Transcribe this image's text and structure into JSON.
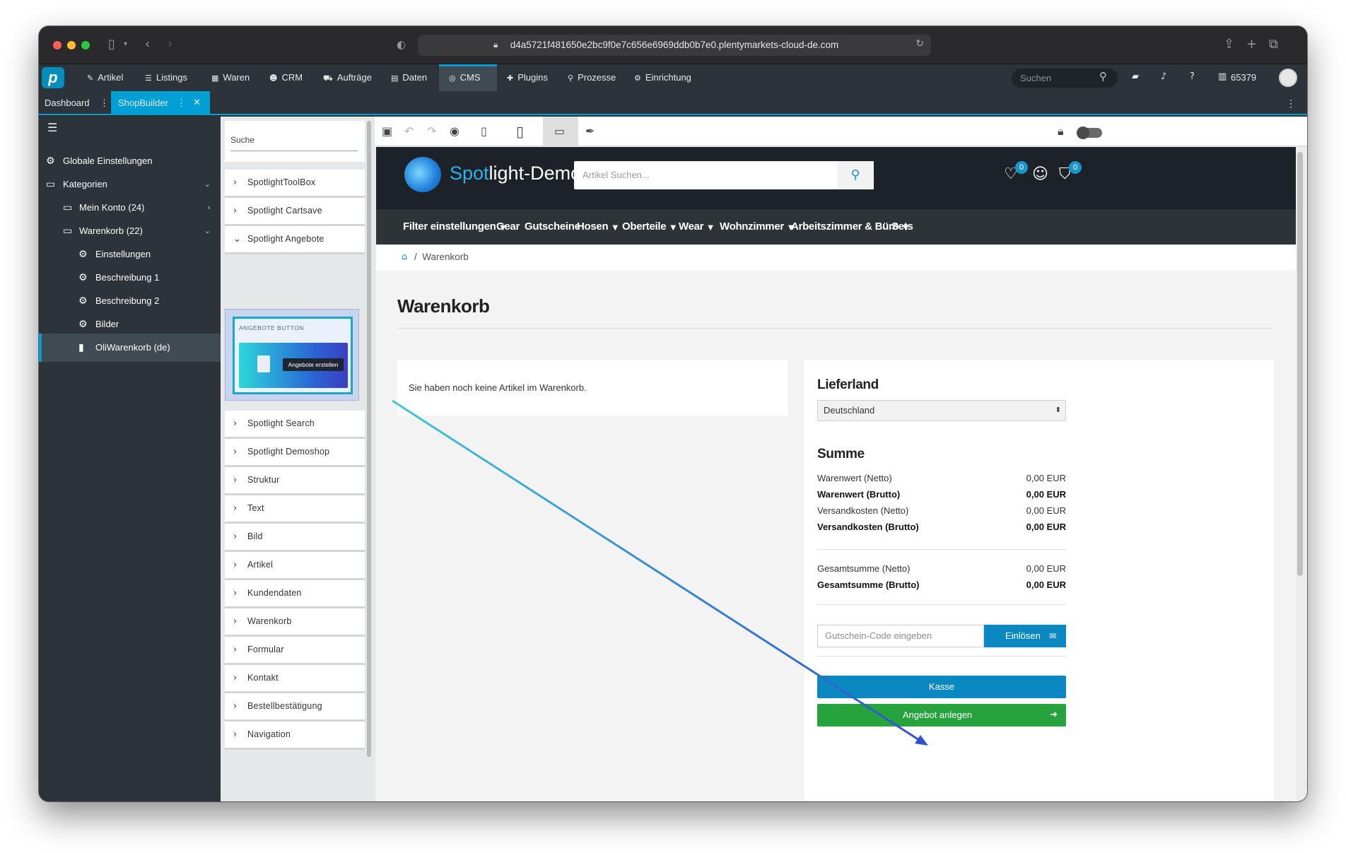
{
  "browser": {
    "url": "d4a5721f481650e2bc9f0e7c656e6969ddb0b7e0.plentymarkets-cloud-de.com"
  },
  "topnav": {
    "items": [
      {
        "label": "Artikel",
        "icon": "tag-icon"
      },
      {
        "label": "Listings",
        "icon": "list-icon"
      },
      {
        "label": "Waren",
        "icon": "boxes-icon"
      },
      {
        "label": "CRM",
        "icon": "users-icon"
      },
      {
        "label": "Aufträge",
        "icon": "cart-icon"
      },
      {
        "label": "Daten",
        "icon": "database-icon"
      },
      {
        "label": "CMS",
        "icon": "cms-icon"
      },
      {
        "label": "Plugins",
        "icon": "puzzle-icon"
      },
      {
        "label": "Prozesse",
        "icon": "flow-icon"
      },
      {
        "label": "Einrichtung",
        "icon": "gear-icon"
      }
    ],
    "active": "CMS",
    "search_placeholder": "Suchen",
    "account_number": "65379"
  },
  "tabs": {
    "dashboard": "Dashboard",
    "shopbuilder": "ShopBuilder"
  },
  "sidebar": {
    "items": [
      {
        "label": "Globale Einstellungen",
        "icon": "gear-icon"
      },
      {
        "label": "Kategorien",
        "icon": "window-icon"
      },
      {
        "label": "Mein Konto (24)",
        "icon": "window-icon"
      },
      {
        "label": "Warenkorb (22)",
        "icon": "window-icon"
      },
      {
        "label": "Einstellungen",
        "icon": "gear-icon"
      },
      {
        "label": "Beschreibung 1",
        "icon": "gear-icon"
      },
      {
        "label": "Beschreibung 2",
        "icon": "gear-icon"
      },
      {
        "label": "Bilder",
        "icon": "gear-icon"
      },
      {
        "label": "OliWarenkorb (de)",
        "icon": "file-icon"
      }
    ],
    "active": "OliWarenkorb (de)"
  },
  "widgets": {
    "search_label": "Suche",
    "items": [
      "SpotlightToolBox",
      "Spotlight Cartsave",
      "Spotlight Angebote",
      "Spotlight Search",
      "Spotlight Demoshop",
      "Struktur",
      "Text",
      "Bild",
      "Artikel",
      "Kundendaten",
      "Warenkorb",
      "Formular",
      "Kontakt",
      "Bestellbestätigung",
      "Navigation"
    ],
    "expanded": "Spotlight Angebote",
    "preview_label": "ANGEBOTE BUTTON",
    "preview_button": "Angebote erstellen"
  },
  "shop": {
    "logo_part1": "Spot",
    "logo_part2": "light-Demos",
    "search_placeholder": "Artikel Suchen...",
    "wishlist_count": "0",
    "cart_count": "0",
    "nav": [
      {
        "label": "Filter einstellungen",
        "dropdown": true
      },
      {
        "label": "Gear",
        "dropdown": false
      },
      {
        "label": "Gutscheine",
        "dropdown": false
      },
      {
        "label": "Hosen",
        "dropdown": true
      },
      {
        "label": "Oberteile",
        "dropdown": true
      },
      {
        "label": "Wear",
        "dropdown": true
      },
      {
        "label": "Wohnzimmer",
        "dropdown": true
      },
      {
        "label": "Arbeitszimmer & Büro",
        "dropdown": true
      },
      {
        "label": "Sets",
        "dropdown": false
      }
    ],
    "breadcrumb_sep": "/",
    "breadcrumb": "Warenkorb",
    "page_title": "Warenkorb",
    "empty_message": "Sie haben noch keine Artikel im Warenkorb.",
    "summary": {
      "country_heading": "Lieferland",
      "country_value": "Deutschland",
      "sum_heading": "Summe",
      "rows": [
        {
          "label": "Warenwert (Netto)",
          "value": "0,00 EUR",
          "bold": false
        },
        {
          "label": "Warenwert (Brutto)",
          "value": "0,00 EUR",
          "bold": true
        },
        {
          "label": "Versandkosten (Netto)",
          "value": "0,00 EUR",
          "bold": false
        },
        {
          "label": "Versandkosten (Brutto)",
          "value": "0,00 EUR",
          "bold": true
        }
      ],
      "totals": [
        {
          "label": "Gesamtsumme (Netto)",
          "value": "0,00 EUR",
          "bold": false
        },
        {
          "label": "Gesamtsumme (Brutto)",
          "value": "0,00 EUR",
          "bold": true
        }
      ],
      "coupon_placeholder": "Gutschein-Code eingeben",
      "redeem_label": "Einlösen",
      "checkout_label": "Kasse",
      "offer_label": "Angebot anlegen"
    }
  },
  "colors": {
    "accent": "#00a0d6",
    "arrow_start": "#41c7d6",
    "arrow_end": "#3250d2",
    "offer_green": "#26a33c",
    "checkout_blue": "#0a89c1"
  }
}
